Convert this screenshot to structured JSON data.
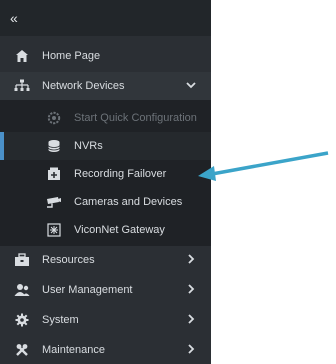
{
  "header": {
    "collapse_label": "«"
  },
  "nav": {
    "home": "Home Page",
    "network_devices": "Network Devices",
    "sub": {
      "quick_config": "Start Quick Configuration",
      "nvrs": "NVRs",
      "recording_failover": "Recording Failover",
      "cameras_devices": "Cameras and Devices",
      "viconnet_gateway": "ViconNet Gateway"
    },
    "resources": "Resources",
    "user_management": "User Management",
    "system": "System",
    "maintenance": "Maintenance"
  },
  "colors": {
    "sidebar_bg": "#2b2f34",
    "submenu_bg": "#1f2226",
    "active_accent": "#4a90c8",
    "callout_arrow": "#3ba4c9"
  },
  "icons": {
    "home": "home-icon",
    "network": "network-tree-icon",
    "quick_config": "gear-icon",
    "nvr": "database-icon",
    "failover": "record-failover-icon",
    "cameras": "camera-icon",
    "gateway": "gateway-icon",
    "resources": "briefcase-icon",
    "users": "users-icon",
    "system": "gear-icon",
    "maintenance": "wrench-icon"
  }
}
